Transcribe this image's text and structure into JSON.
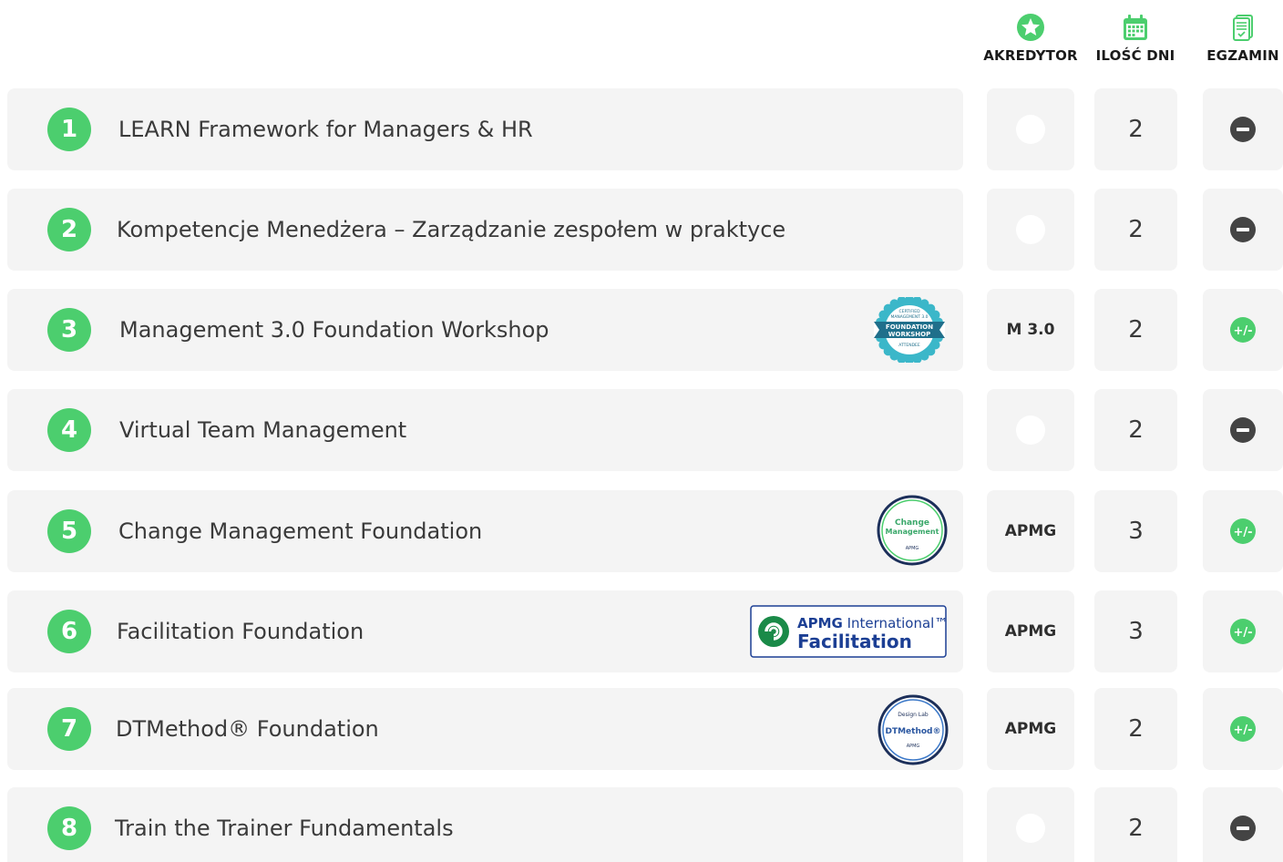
{
  "header": {
    "columns": [
      {
        "key": "akredytor",
        "label": "AKREDYTOR",
        "icon": "star-badge-icon"
      },
      {
        "key": "dni",
        "label": "ILOŚĆ DNI",
        "icon": "calendar-icon"
      },
      {
        "key": "egzamin",
        "label": "EGZAMIN",
        "icon": "exam-document-icon"
      }
    ]
  },
  "colors": {
    "accent_green": "#4cce6e",
    "card_bg": "#f4f4f4",
    "minus_icon": "#444444"
  },
  "rows": [
    {
      "number": "1",
      "title": "LEARN Framework for Managers & HR",
      "akredytor": "",
      "dni": "2",
      "egzamin": "minus",
      "badge": null
    },
    {
      "number": "2",
      "title": "Kompetencje Menedżera – Zarządzanie zespołem w praktyce",
      "akredytor": "",
      "dni": "2",
      "egzamin": "minus",
      "badge": null
    },
    {
      "number": "3",
      "title": "Management 3.0 Foundation Workshop",
      "akredytor": "M 3.0",
      "dni": "2",
      "egzamin": "plus-minus",
      "badge": {
        "type": "seal",
        "lines": [
          "CERTIFIED",
          "MANAGEMENT 3.0",
          "FOUNDATION",
          "WORKSHOP",
          "ATTENDEE"
        ]
      }
    },
    {
      "number": "4",
      "title": "Virtual Team Management",
      "akredytor": "",
      "dni": "2",
      "egzamin": "minus",
      "badge": null
    },
    {
      "number": "5",
      "title": "Change Management Foundation",
      "akredytor": "APMG",
      "dni": "3",
      "egzamin": "plus-minus",
      "badge": {
        "type": "circle",
        "lines": [
          "Change",
          "Management",
          "APMG"
        ]
      }
    },
    {
      "number": "6",
      "title": "Facilitation Foundation",
      "akredytor": "APMG",
      "dni": "3",
      "egzamin": "plus-minus",
      "badge": {
        "type": "rect",
        "lines": [
          "APMG",
          "International™",
          "Facilitation"
        ]
      }
    },
    {
      "number": "7",
      "title": "DTMethod® Foundation",
      "akredytor": "APMG",
      "dni": "2",
      "egzamin": "plus-minus",
      "badge": {
        "type": "circle2",
        "lines": [
          "Design Lab",
          "DTMethod®",
          "APMG"
        ]
      }
    },
    {
      "number": "8",
      "title": "Train the Trainer Fundamentals",
      "akredytor": "",
      "dni": "2",
      "egzamin": "minus",
      "badge": null
    }
  ]
}
